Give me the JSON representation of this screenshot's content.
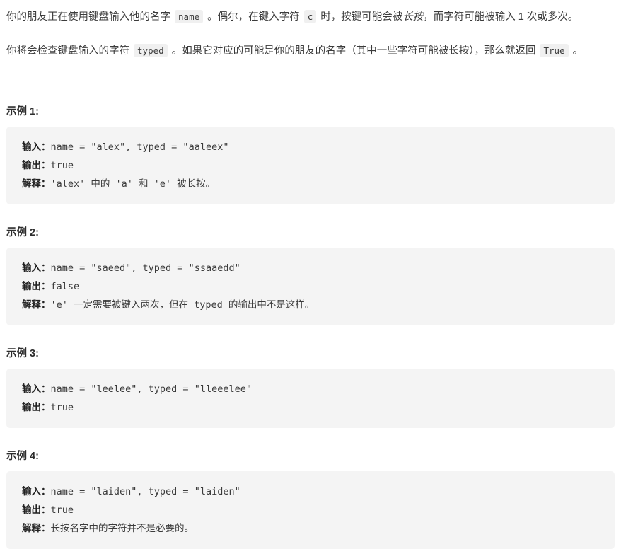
{
  "intro": {
    "paragraph_1": {
      "seg_1": "你的朋友正在使用键盘输入他的名字 ",
      "code_1": "name",
      "seg_2": " 。偶尔，在键入字符 ",
      "code_2": "c",
      "seg_3": " 时，按键可能会被",
      "italic_1": "长按",
      "seg_4": "，而字符可能被输入 1 次或多次。"
    },
    "paragraph_2": {
      "seg_1": "你将会检查键盘输入的字符 ",
      "code_1": "typed",
      "seg_2": " 。如果它对应的可能是你的朋友的名字（其中一些字符可能被长按），那么就返回 ",
      "code_2": "True",
      "seg_3": " 。"
    }
  },
  "labels": {
    "input": "输入：",
    "output": "输出：",
    "explanation": "解释："
  },
  "examples": [
    {
      "heading": "示例 1:",
      "input": "name = \"alex\", typed = \"aaleex\"",
      "output": "true",
      "explanation_prefix": "'alex' ",
      "explanation_cjk_1": "中的",
      "explanation_mid_1": " 'a' ",
      "explanation_cjk_2": "和",
      "explanation_mid_2": " 'e' ",
      "explanation_cjk_3": "被长按。"
    },
    {
      "heading": "示例 2:",
      "input": "name = \"saeed\", typed = \"ssaaedd\"",
      "output": "false",
      "explanation_prefix": "'e' ",
      "explanation_cjk_1": "一定需要被键入两次，但在",
      "explanation_mid_1": " typed ",
      "explanation_cjk_2": "的输出中不是这样。",
      "explanation_mid_2": "",
      "explanation_cjk_3": ""
    },
    {
      "heading": "示例 3:",
      "input": "name = \"leelee\", typed = \"lleeelee\"",
      "output": "true",
      "explanation_prefix": "",
      "explanation_cjk_1": "",
      "explanation_mid_1": "",
      "explanation_cjk_2": "",
      "explanation_mid_2": "",
      "explanation_cjk_3": ""
    },
    {
      "heading": "示例 4:",
      "input": "name = \"laiden\", typed = \"laiden\"",
      "output": "true",
      "explanation_prefix": "",
      "explanation_cjk_1": "长按名字中的字符并不是必要的。",
      "explanation_mid_1": "",
      "explanation_cjk_2": "",
      "explanation_mid_2": "",
      "explanation_cjk_3": ""
    }
  ],
  "colors": {
    "page_bg": "#ffffff",
    "text": "#3b3b3b",
    "code_block_bg": "#f4f4f4",
    "inline_code_bg": "#f0f0f0",
    "heading": "#2d2d2d"
  }
}
